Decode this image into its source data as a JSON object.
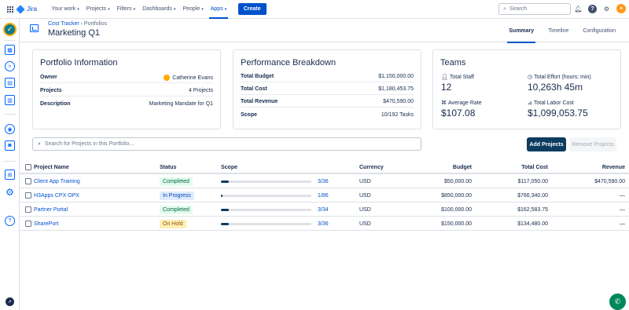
{
  "topbar": {
    "product": "Jira",
    "nav": [
      {
        "label": "Your work",
        "chevron": true
      },
      {
        "label": "Projects",
        "chevron": true
      },
      {
        "label": "Filters",
        "chevron": true
      },
      {
        "label": "Dashboards",
        "chevron": true
      },
      {
        "label": "People",
        "chevron": true
      },
      {
        "label": "Apps",
        "chevron": true,
        "active": true
      }
    ],
    "create_label": "Create",
    "search_placeholder": "Search"
  },
  "header": {
    "breadcrumb": [
      "Cost Tracker",
      "Portfolios"
    ],
    "title": "Marketing Q1",
    "tabs": [
      "Summary",
      "Timeline",
      "Configuration"
    ],
    "active_tab": "Summary"
  },
  "portfolio_info": {
    "title": "Portfolio Information",
    "owner_label": "Owner",
    "owner_value": "Catherine Evans",
    "projects_label": "Projects",
    "projects_value": "4 Projects",
    "description_label": "Description",
    "description_value": "Marketing Mandate for Q1"
  },
  "performance": {
    "title": "Performance Breakdown",
    "rows": [
      {
        "label": "Total Budget",
        "value": "$1,150,000.00"
      },
      {
        "label": "Total Cost",
        "value": "$1,180,453.75"
      },
      {
        "label": "Total Revenue",
        "value": "$470,590.00"
      },
      {
        "label": "Scope",
        "value": "10/192 Tasks"
      }
    ]
  },
  "teams": {
    "title": "Teams",
    "total_staff_label": "Total Staff",
    "total_staff_value": "12",
    "total_effort_label": "Total Effort (hours: min)",
    "total_effort_value": "10,263h 45m",
    "average_rate_label": "Average Rate",
    "average_rate_value": "$107.08",
    "total_labor_label": "Total Labor Cost",
    "total_labor_value": "$1,099,053.75"
  },
  "toolbar": {
    "search_placeholder": "Search for Projects in this Portfolio...",
    "add_label": "Add Projects",
    "remove_label": "Remove Projects"
  },
  "table": {
    "headers": {
      "project": "Project Name",
      "status": "Status",
      "scope": "Scope",
      "currency": "Currency",
      "budget": "Budget",
      "total_cost": "Total Cost",
      "revenue": "Revenue"
    },
    "rows": [
      {
        "project": "Client App Training",
        "status": "Completed",
        "status_bg": "#e3fcef",
        "status_fg": "#006644",
        "scope_done": 3,
        "scope_total": 36,
        "scope_text": "3/36",
        "currency": "USD",
        "budget": "$50,000.00",
        "total_cost": "$117,050.00",
        "revenue": "$470,590.00"
      },
      {
        "project": "H3Apps CPX OPX",
        "status": "In Progress",
        "status_bg": "#deebff",
        "status_fg": "#0747a6",
        "scope_done": 1,
        "scope_total": 86,
        "scope_text": "1/86",
        "currency": "USD",
        "budget": "$850,000.00",
        "total_cost": "$766,340.00",
        "revenue": "—"
      },
      {
        "project": "Partner Portal",
        "status": "Completed",
        "status_bg": "#e3fcef",
        "status_fg": "#006644",
        "scope_done": 3,
        "scope_total": 34,
        "scope_text": "3/34",
        "currency": "USD",
        "budget": "$100,000.00",
        "total_cost": "$162,583.75",
        "revenue": "—"
      },
      {
        "project": "SharePort",
        "status": "On Hold",
        "status_bg": "#fff0b3",
        "status_fg": "#974f0c",
        "scope_done": 3,
        "scope_total": 36,
        "scope_text": "3/36",
        "currency": "USD",
        "budget": "$150,000.00",
        "total_cost": "$134,480.00",
        "revenue": "—"
      }
    ]
  },
  "colors": {
    "brand": "#0052cc",
    "primary_button": "#0c3c5f",
    "chat_button": "#00875a"
  },
  "icons": {
    "topbar": [
      "app-switcher-icon",
      "jira-logo-icon",
      "search-icon",
      "notifications-icon",
      "help-icon",
      "settings-icon",
      "profile-avatar"
    ],
    "sidebar": [
      "cost-tracker-icon",
      "calendar-icon",
      "forward-icon",
      "folder-icon",
      "report-icon",
      "team-icon",
      "badge-icon",
      "apps-grid-icon",
      "settings-gear-icon",
      "help-circle-icon",
      "rocket-icon"
    ]
  }
}
